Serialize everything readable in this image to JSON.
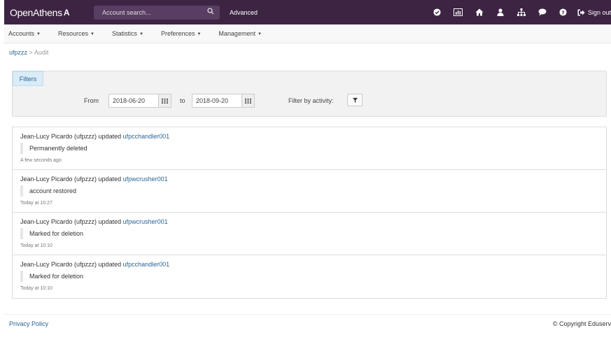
{
  "brand": {
    "logo_text": "OpenAthens",
    "logo_mark": "A"
  },
  "search": {
    "placeholder": "Account search...",
    "advanced_label": "Advanced"
  },
  "topbar": {
    "signout_label": "Sign out"
  },
  "nav": {
    "items": [
      {
        "label": "Accounts"
      },
      {
        "label": "Resources"
      },
      {
        "label": "Statistics"
      },
      {
        "label": "Preferences"
      },
      {
        "label": "Management"
      }
    ]
  },
  "breadcrumb": {
    "root": "ufpzzz",
    "separator": ">",
    "current": "Audit"
  },
  "filters": {
    "tab_label": "Filters",
    "from_label": "From",
    "from_value": "2018-06-20",
    "to_label": "to",
    "to_value": "2018-09-20",
    "activity_label": "Filter by activity:"
  },
  "entries": [
    {
      "actor": "Jean-Lucy Picardo (ufpzzz) updated",
      "target": "ufpcchandler001",
      "action": "Permanently deleted",
      "time": "A few seconds ago"
    },
    {
      "actor": "Jean-Lucy Picardo (ufpzzz) updated",
      "target": "ufpwcrusher001",
      "action": "account restored",
      "time": "Today at 10:27"
    },
    {
      "actor": "Jean-Lucy Picardo (ufpzzz) updated",
      "target": "ufpwcrusher001",
      "action": "Marked for deletion",
      "time": "Today at 10:10"
    },
    {
      "actor": "Jean-Lucy Picardo (ufpzzz) updated",
      "target": "ufpcchandler001",
      "action": "Marked for deletion",
      "time": "Today at 10:10"
    }
  ],
  "footer": {
    "privacy_label": "Privacy Policy",
    "copyright": "© Copyright Eduserv"
  },
  "colors": {
    "topbar": "#3d2443",
    "link": "#2a6496",
    "filters_tab": "#d9ecf7"
  },
  "icons": [
    "search-icon",
    "check-circle-icon",
    "bar-chart-icon",
    "home-icon",
    "user-icon",
    "sitemap-icon",
    "comment-icon",
    "question-icon",
    "sign-out-icon",
    "calendar-icon",
    "filter-icon"
  ]
}
